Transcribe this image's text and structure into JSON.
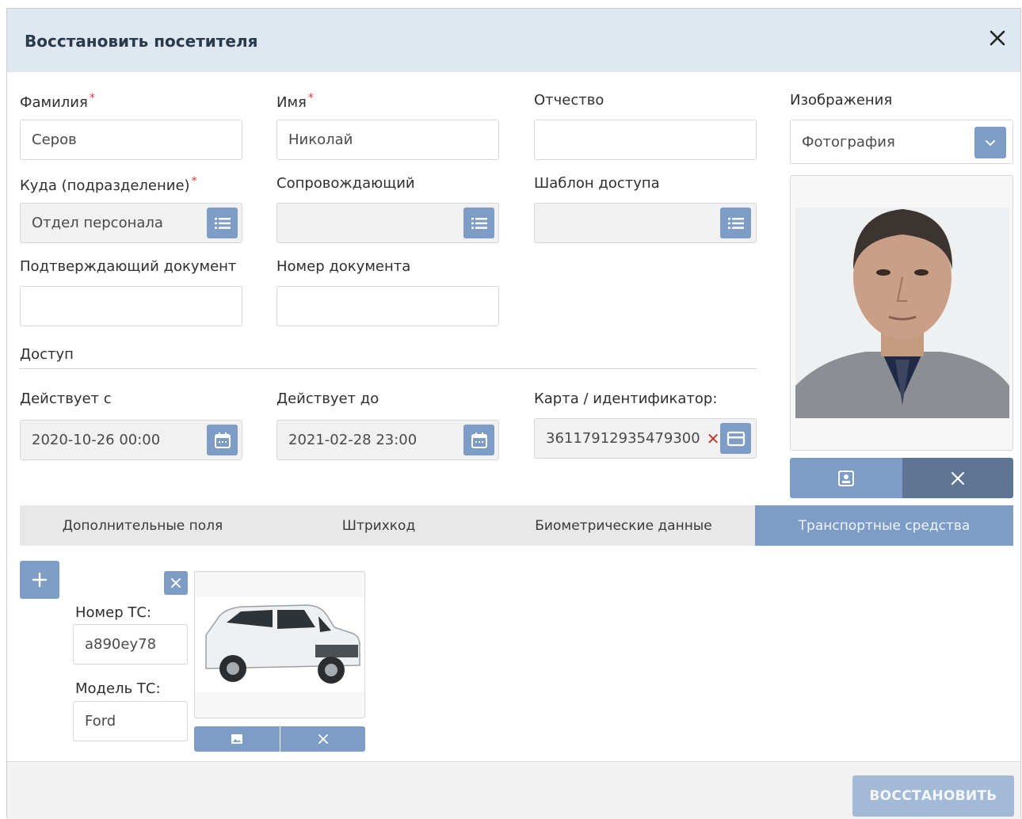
{
  "dialog": {
    "title": "Восстановить посетителя",
    "close_icon": "close-icon"
  },
  "form": {
    "last_name": {
      "label": "Фамилия",
      "value": "Серов",
      "required": true
    },
    "first_name": {
      "label": "Имя",
      "value": "Николай",
      "required": true
    },
    "patronymic": {
      "label": "Отчество",
      "value": ""
    },
    "department": {
      "label": "Куда (подразделение)",
      "value": "Отдел персонала",
      "required": true
    },
    "escort": {
      "label": "Сопровождающий",
      "value": ""
    },
    "access_template": {
      "label": "Шаблон доступа",
      "value": ""
    },
    "document": {
      "label": "Подтверждающий документ",
      "value": ""
    },
    "document_number": {
      "label": "Номер документа",
      "value": ""
    },
    "access_section": "Доступ",
    "valid_from": {
      "label": "Действует с",
      "value": "2020-10-26 00:00"
    },
    "valid_to": {
      "label": "Действует до",
      "value": "2021-02-28 23:00"
    },
    "card": {
      "label": "Карта / идентификатор:",
      "value": "36117912935479300"
    }
  },
  "images": {
    "label": "Изображения",
    "selected": "Фотография"
  },
  "tabs": [
    {
      "label": "Дополнительные поля",
      "active": false
    },
    {
      "label": "Штрихкод",
      "active": false
    },
    {
      "label": "Биометрические данные",
      "active": false
    },
    {
      "label": "Транспортные средства",
      "active": true
    }
  ],
  "vehicle": {
    "number_label": "Номер ТС:",
    "number_value": "а890еу78",
    "model_label": "Модель ТС:",
    "model_value": "Ford"
  },
  "footer": {
    "restore_label": "ВОССТАНОВИТЬ"
  },
  "colors": {
    "header_bg": "#dfe8f1",
    "accent": "#7d9dc6",
    "accent_dark": "#5e7594",
    "required": "#e23636"
  }
}
